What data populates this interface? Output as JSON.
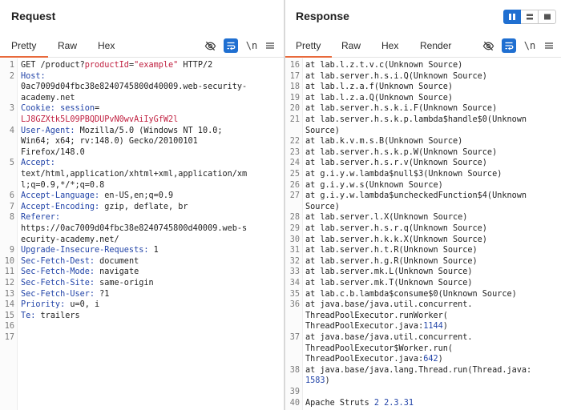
{
  "request": {
    "title": "Request",
    "tabs": [
      "Pretty",
      "Raw",
      "Hex"
    ],
    "active_tab": "Pretty",
    "newline_toggle": "\\n",
    "lines": [
      {
        "n": "1",
        "segs": [
          {
            "t": "GET /product?",
            "c": ""
          },
          {
            "t": "productId",
            "c": "pk"
          },
          {
            "t": "=",
            "c": ""
          },
          {
            "t": "\"example\"",
            "c": "pk"
          },
          {
            "t": " HTTP/2",
            "c": ""
          }
        ]
      },
      {
        "n": "2",
        "segs": [
          {
            "t": "Host:",
            "c": "hk"
          }
        ]
      },
      {
        "n": "",
        "segs": [
          {
            "t": "0ac7009d04fbc38e8240745800d40009.web-security-",
            "c": ""
          }
        ]
      },
      {
        "n": "",
        "segs": [
          {
            "t": "academy.net",
            "c": ""
          }
        ]
      },
      {
        "n": "3",
        "segs": [
          {
            "t": "Cookie: ",
            "c": "hk"
          },
          {
            "t": "session",
            "c": "hk"
          },
          {
            "t": "=",
            "c": ""
          }
        ]
      },
      {
        "n": "",
        "segs": [
          {
            "t": "LJ8GZXtk5L09PBQDUPvN0wvAiIyGfW2l",
            "c": "cv"
          }
        ]
      },
      {
        "n": "4",
        "segs": [
          {
            "t": "User-Agent: ",
            "c": "hk"
          },
          {
            "t": "Mozilla/5.0 (Windows NT 10.0;",
            "c": ""
          }
        ]
      },
      {
        "n": "",
        "segs": [
          {
            "t": "Win64; x64; rv:148.0) Gecko/20100101",
            "c": ""
          }
        ]
      },
      {
        "n": "",
        "segs": [
          {
            "t": "Firefox/148.0",
            "c": ""
          }
        ]
      },
      {
        "n": "5",
        "segs": [
          {
            "t": "Accept:",
            "c": "hk"
          }
        ]
      },
      {
        "n": "",
        "segs": [
          {
            "t": "text/html,application/xhtml+xml,application/xm",
            "c": ""
          }
        ]
      },
      {
        "n": "",
        "segs": [
          {
            "t": "l;q=0.9,*/*;q=0.8",
            "c": ""
          }
        ]
      },
      {
        "n": "6",
        "segs": [
          {
            "t": "Accept-Language: ",
            "c": "hk"
          },
          {
            "t": "en-US,en;q=0.9",
            "c": ""
          }
        ]
      },
      {
        "n": "7",
        "segs": [
          {
            "t": "Accept-Encoding: ",
            "c": "hk"
          },
          {
            "t": "gzip, deflate, br",
            "c": ""
          }
        ]
      },
      {
        "n": "8",
        "segs": [
          {
            "t": "Referer:",
            "c": "hk"
          }
        ]
      },
      {
        "n": "",
        "segs": [
          {
            "t": "https://0ac7009d04fbc38e8240745800d40009.web-s",
            "c": ""
          }
        ]
      },
      {
        "n": "",
        "segs": [
          {
            "t": "ecurity-academy.net/",
            "c": ""
          }
        ]
      },
      {
        "n": "9",
        "segs": [
          {
            "t": "Upgrade-Insecure-Requests: ",
            "c": "hk"
          },
          {
            "t": "1",
            "c": ""
          }
        ]
      },
      {
        "n": "10",
        "segs": [
          {
            "t": "Sec-Fetch-Dest: ",
            "c": "hk"
          },
          {
            "t": "document",
            "c": ""
          }
        ]
      },
      {
        "n": "11",
        "segs": [
          {
            "t": "Sec-Fetch-Mode: ",
            "c": "hk"
          },
          {
            "t": "navigate",
            "c": ""
          }
        ]
      },
      {
        "n": "12",
        "segs": [
          {
            "t": "Sec-Fetch-Site: ",
            "c": "hk"
          },
          {
            "t": "same-origin",
            "c": ""
          }
        ]
      },
      {
        "n": "13",
        "segs": [
          {
            "t": "Sec-Fetch-User: ",
            "c": "hk"
          },
          {
            "t": "?1",
            "c": ""
          }
        ]
      },
      {
        "n": "14",
        "segs": [
          {
            "t": "Priority: ",
            "c": "hk"
          },
          {
            "t": "u=0, i",
            "c": ""
          }
        ]
      },
      {
        "n": "15",
        "segs": [
          {
            "t": "Te: ",
            "c": "hk"
          },
          {
            "t": "trailers",
            "c": ""
          }
        ]
      },
      {
        "n": "16",
        "segs": []
      },
      {
        "n": "17",
        "segs": []
      }
    ]
  },
  "response": {
    "title": "Response",
    "tabs": [
      "Pretty",
      "Raw",
      "Hex",
      "Render"
    ],
    "active_tab": "Pretty",
    "newline_toggle": "\\n",
    "lines": [
      {
        "n": "16",
        "segs": [
          {
            "t": "at lab.l.z.t.v.c(Unknown Source)",
            "c": ""
          }
        ]
      },
      {
        "n": "17",
        "segs": [
          {
            "t": "at lab.server.h.s.i.Q(Unknown Source)",
            "c": ""
          }
        ]
      },
      {
        "n": "18",
        "segs": [
          {
            "t": "at lab.l.z.a.f(Unknown Source)",
            "c": ""
          }
        ]
      },
      {
        "n": "19",
        "segs": [
          {
            "t": "at lab.l.z.a.Q(Unknown Source)",
            "c": ""
          }
        ]
      },
      {
        "n": "20",
        "segs": [
          {
            "t": "at lab.server.h.s.k.i.F(Unknown Source)",
            "c": ""
          }
        ]
      },
      {
        "n": "21",
        "segs": [
          {
            "t": "at lab.server.h.s.k.p.lambda$handle$0(Unknown",
            "c": ""
          }
        ]
      },
      {
        "n": "",
        "segs": [
          {
            "t": "Source)",
            "c": ""
          }
        ]
      },
      {
        "n": "22",
        "segs": [
          {
            "t": "at lab.k.v.m.s.B(Unknown Source)",
            "c": ""
          }
        ]
      },
      {
        "n": "23",
        "segs": [
          {
            "t": "at lab.server.h.s.k.p.W(Unknown Source)",
            "c": ""
          }
        ]
      },
      {
        "n": "24",
        "segs": [
          {
            "t": "at lab.server.h.s.r.v(Unknown Source)",
            "c": ""
          }
        ]
      },
      {
        "n": "25",
        "segs": [
          {
            "t": "at g.i.y.w.lambda$null$3(Unknown Source)",
            "c": ""
          }
        ]
      },
      {
        "n": "26",
        "segs": [
          {
            "t": "at g.i.y.w.s(Unknown Source)",
            "c": ""
          }
        ]
      },
      {
        "n": "27",
        "segs": [
          {
            "t": "at g.i.y.w.lambda$uncheckedFunction$4(Unknown",
            "c": ""
          }
        ]
      },
      {
        "n": "",
        "segs": [
          {
            "t": "Source)",
            "c": ""
          }
        ]
      },
      {
        "n": "28",
        "segs": [
          {
            "t": "at lab.server.l.X(Unknown Source)",
            "c": ""
          }
        ]
      },
      {
        "n": "29",
        "segs": [
          {
            "t": "at lab.server.h.s.r.q(Unknown Source)",
            "c": ""
          }
        ]
      },
      {
        "n": "30",
        "segs": [
          {
            "t": "at lab.server.h.k.k.X(Unknown Source)",
            "c": ""
          }
        ]
      },
      {
        "n": "31",
        "segs": [
          {
            "t": "at lab.server.h.t.R(Unknown Source)",
            "c": ""
          }
        ]
      },
      {
        "n": "32",
        "segs": [
          {
            "t": "at lab.server.h.g.R(Unknown Source)",
            "c": ""
          }
        ]
      },
      {
        "n": "33",
        "segs": [
          {
            "t": "at lab.server.mk.L(Unknown Source)",
            "c": ""
          }
        ]
      },
      {
        "n": "34",
        "segs": [
          {
            "t": "at lab.server.mk.T(Unknown Source)",
            "c": ""
          }
        ]
      },
      {
        "n": "35",
        "segs": [
          {
            "t": "at lab.c.b.lambda$consume$0(Unknown Source)",
            "c": ""
          }
        ]
      },
      {
        "n": "36",
        "segs": [
          {
            "t": "at java.base/java.util.concurrent.",
            "c": ""
          }
        ]
      },
      {
        "n": "",
        "segs": [
          {
            "t": "ThreadPoolExecutor.runWorker(",
            "c": ""
          }
        ]
      },
      {
        "n": "",
        "segs": [
          {
            "t": "ThreadPoolExecutor.java:",
            "c": ""
          },
          {
            "t": "1144",
            "c": "num"
          },
          {
            "t": ")",
            "c": ""
          }
        ]
      },
      {
        "n": "37",
        "segs": [
          {
            "t": "at java.base/java.util.concurrent.",
            "c": ""
          }
        ]
      },
      {
        "n": "",
        "segs": [
          {
            "t": "ThreadPoolExecutor$Worker.run(",
            "c": ""
          }
        ]
      },
      {
        "n": "",
        "segs": [
          {
            "t": "ThreadPoolExecutor.java:",
            "c": ""
          },
          {
            "t": "642",
            "c": "num"
          },
          {
            "t": ")",
            "c": ""
          }
        ]
      },
      {
        "n": "38",
        "segs": [
          {
            "t": "at java.base/java.lang.Thread.run(Thread.java:",
            "c": ""
          }
        ]
      },
      {
        "n": "",
        "segs": [
          {
            "t": "1583",
            "c": "num"
          },
          {
            "t": ")",
            "c": ""
          }
        ]
      },
      {
        "n": "39",
        "segs": []
      },
      {
        "n": "40",
        "segs": [
          {
            "t": "Apache Struts ",
            "c": ""
          },
          {
            "t": "2",
            "c": "num"
          },
          {
            "t": " ",
            "c": ""
          },
          {
            "t": "2.3.31",
            "c": "num"
          }
        ]
      }
    ]
  },
  "icons": {
    "eye_off": "eye-off-icon",
    "wrap": "wrap-icon",
    "menu": "menu-icon",
    "layout_split": "split-columns-icon",
    "layout_rows": "split-rows-icon",
    "layout_single": "single-pane-icon"
  },
  "colors": {
    "accent_tab": "#e8693b",
    "header_key": "#2244a8",
    "param": "#c02040",
    "toolbar_blue": "#1f6fd1"
  }
}
